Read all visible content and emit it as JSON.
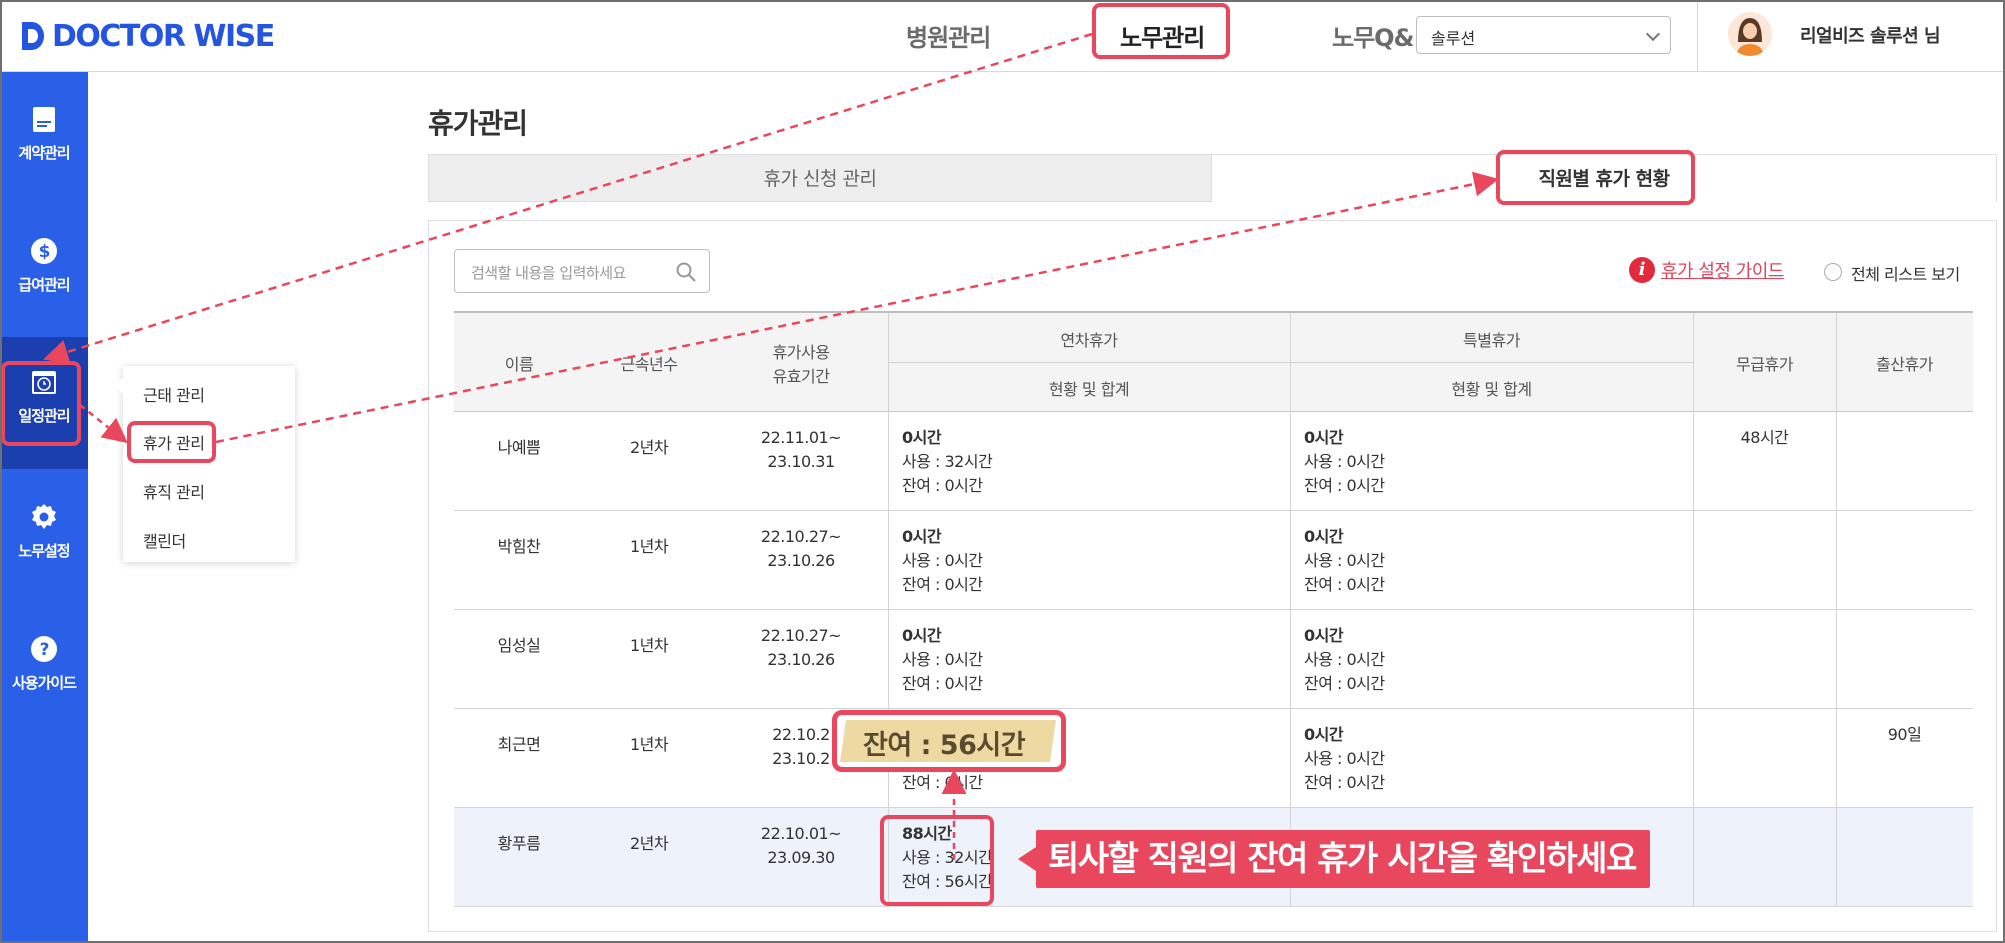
{
  "header": {
    "logo_text": "DOCTOR WISE",
    "nav": [
      "병원관리",
      "노무관리",
      "노무Q&"
    ],
    "select_value": "솔루션",
    "user_name": "리얼비즈 솔루션 님"
  },
  "sidebar": {
    "items": [
      "계약관리",
      "급여관리",
      "일정관리",
      "노무설정",
      "사용가이드"
    ]
  },
  "popup_menu": {
    "items": [
      "근태 관리",
      "휴가 관리",
      "휴직 관리",
      "캘린더"
    ]
  },
  "page": {
    "title": "휴가관리",
    "tabs": [
      "휴가 신청 관리",
      "직원별 휴가 현황"
    ],
    "search_placeholder": "검색할 내용을 입력하세요",
    "guide_icon": "i",
    "guide_link": "휴가 설정 가이드",
    "show_all_label": "전체 리스트 보기"
  },
  "table": {
    "headers": {
      "name": "이름",
      "tenure": "근속년수",
      "valid_line1": "휴가사용",
      "valid_line2": "유효기간",
      "annual": "연차휴가",
      "annual_sub": "현황 및 합계",
      "special": "특별휴가",
      "special_sub": "현황 및 합계",
      "unpaid": "무급휴가",
      "maternity": "출산휴가"
    },
    "rows": [
      {
        "name": "나예쁨",
        "tenure": "2년차",
        "valid_from": "22.11.01~",
        "valid_to": "23.10.31",
        "annual_total": "0시간",
        "annual_used": "사용 : 32시간",
        "annual_left": "잔여 : 0시간",
        "special_total": "0시간",
        "special_used": "사용 : 0시간",
        "special_left": "잔여 : 0시간",
        "unpaid": "48시간",
        "maternity": ""
      },
      {
        "name": "박힘찬",
        "tenure": "1년차",
        "valid_from": "22.10.27~",
        "valid_to": "23.10.26",
        "annual_total": "0시간",
        "annual_used": "사용 : 0시간",
        "annual_left": "잔여 : 0시간",
        "special_total": "0시간",
        "special_used": "사용 : 0시간",
        "special_left": "잔여 : 0시간",
        "unpaid": "",
        "maternity": ""
      },
      {
        "name": "임성실",
        "tenure": "1년차",
        "valid_from": "22.10.27~",
        "valid_to": "23.10.26",
        "annual_total": "0시간",
        "annual_used": "사용 : 0시간",
        "annual_left": "잔여 : 0시간",
        "special_total": "0시간",
        "special_used": "사용 : 0시간",
        "special_left": "잔여 : 0시간",
        "unpaid": "",
        "maternity": ""
      },
      {
        "name": "최근면",
        "tenure": "1년차",
        "valid_from": "22.10.2",
        "valid_to": "23.10.2",
        "annual_total": "",
        "annual_used": "",
        "annual_left": "잔여 : 0시간",
        "special_total": "0시간",
        "special_used": "사용 : 0시간",
        "special_left": "잔여 : 0시간",
        "unpaid": "",
        "maternity": "90일"
      },
      {
        "name": "황푸름",
        "tenure": "2년차",
        "valid_from": "22.10.01~",
        "valid_to": "23.09.30",
        "annual_total": "88시간",
        "annual_used": "사용 : 32시간",
        "annual_left": "잔여 : 56시간",
        "special_total": "",
        "special_used": "",
        "special_left": "",
        "unpaid": "",
        "maternity": ""
      }
    ]
  },
  "annotations": {
    "zoom_text": "잔여 : 56시간",
    "callout_text": "퇴사할 직원의 잔여 휴가 시간을 확인하세요"
  },
  "colors": {
    "brand_blue": "#2a5fe8",
    "annotation_red": "#e8475e",
    "highlight_row": "#eef2fb"
  }
}
